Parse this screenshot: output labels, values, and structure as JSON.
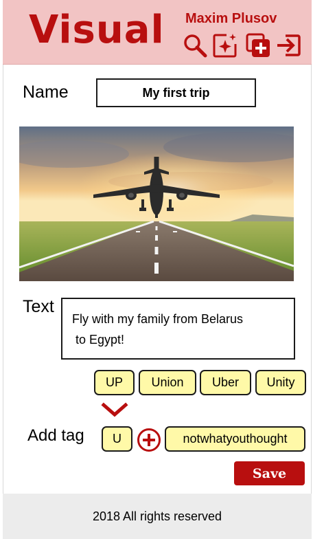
{
  "header": {
    "logo": "Visual",
    "user_name": "Maxim Plusov",
    "icons": [
      "search-icon",
      "sparkle-add-icon",
      "add-copy-icon",
      "sign-in-icon"
    ],
    "background": "#f2c4c4",
    "accent": "#b80f0f"
  },
  "trip": {
    "name_label": "Name",
    "name_value": "My first trip",
    "photo_icon": "airplane-runway-photo",
    "text_label": "Text",
    "text_value": "Fly with my family from Belarus\n to Egypt!"
  },
  "tags": {
    "suggestions": [
      "UP",
      "Union",
      "Uber",
      "Unity"
    ],
    "add_label": "Add tag",
    "input_value": "U",
    "added": [
      "notwhatyouthought"
    ],
    "tag_color": "#fff9a8"
  },
  "actions": {
    "save_label": "Save"
  },
  "footer": {
    "text": "2018  All rights reserved"
  }
}
